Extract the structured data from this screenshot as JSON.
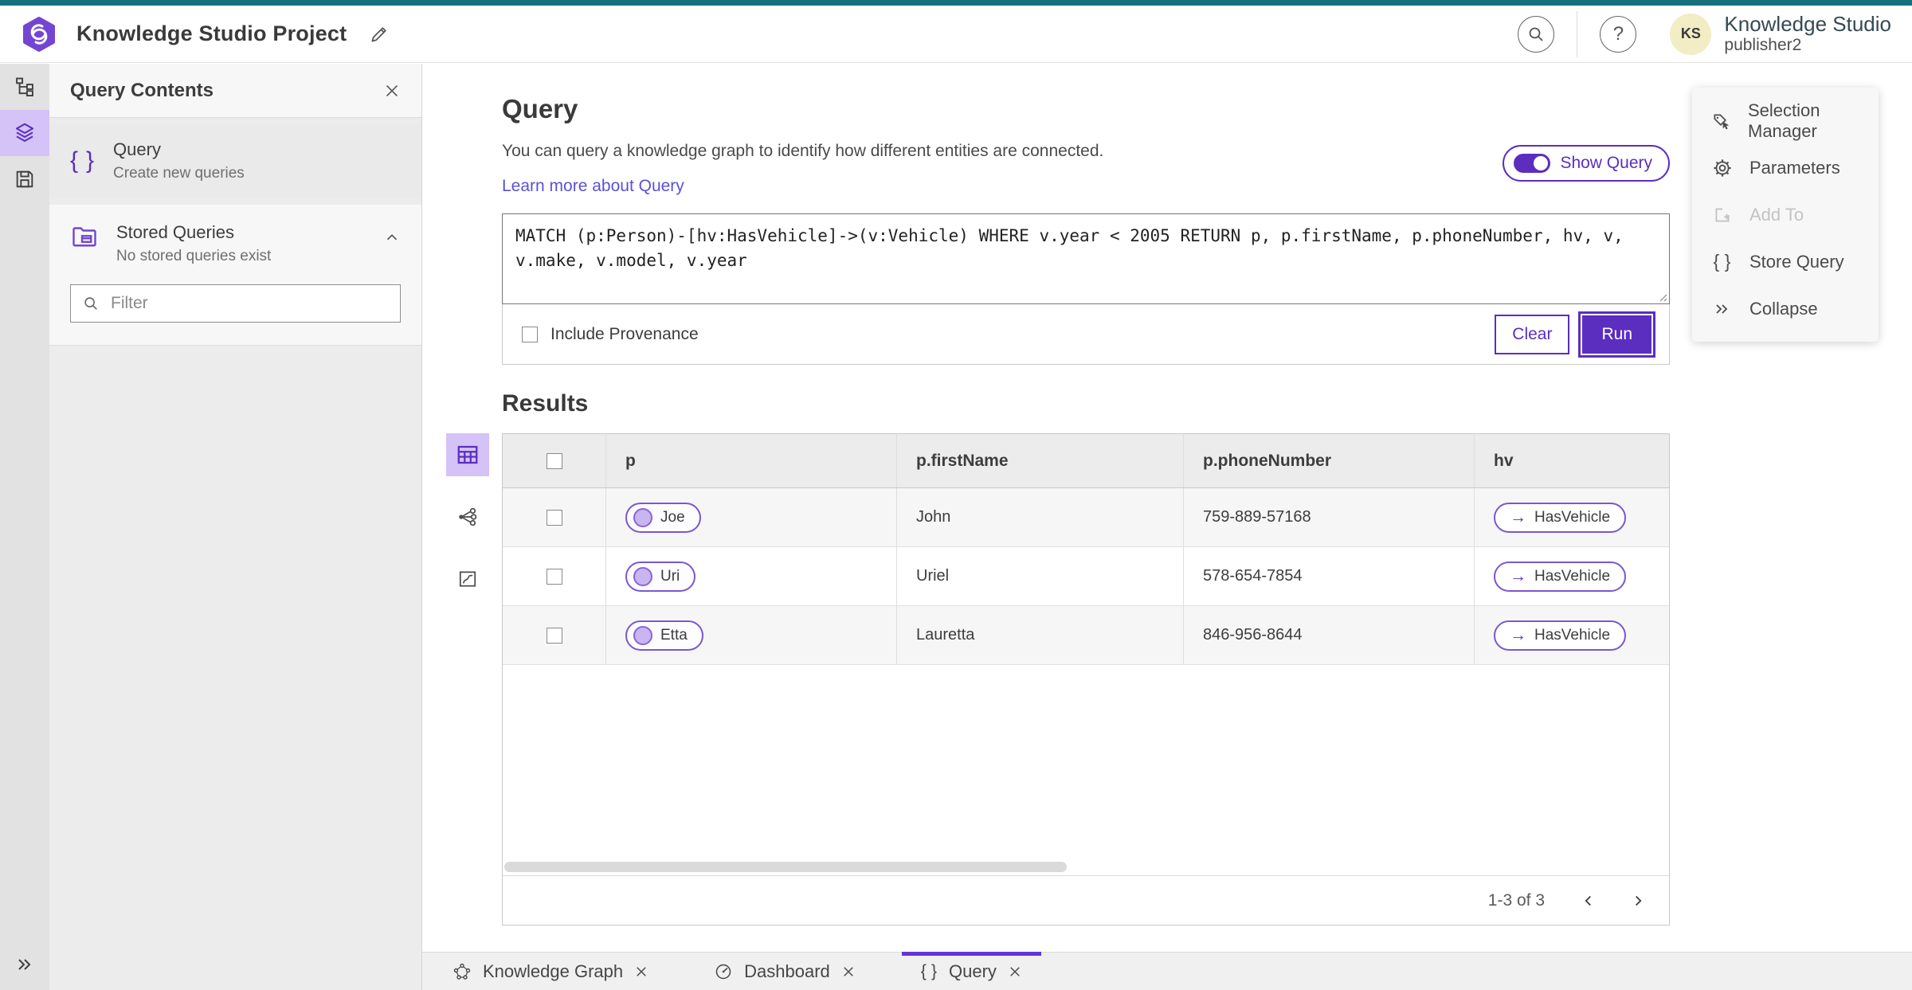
{
  "header": {
    "app_title": "Knowledge Studio Project",
    "user_name": "Knowledge Studio",
    "user_role": "publisher2",
    "avatar_initials": "KS"
  },
  "left_panel": {
    "title": "Query Contents",
    "query_item": {
      "title": "Query",
      "subtitle": "Create new queries"
    },
    "stored_queries": {
      "title": "Stored Queries",
      "subtitle": "No stored queries exist"
    },
    "filter_placeholder": "Filter"
  },
  "query_section": {
    "title": "Query",
    "description": "You can query a knowledge graph to identify how different entities are connected.",
    "learn_more": "Learn more about Query",
    "show_query_label": "Show Query",
    "query_text": "MATCH (p:Person)-[hv:HasVehicle]->(v:Vehicle) WHERE v.year < 2005 RETURN p, p.firstName, p.phoneNumber, hv, v, v.make, v.model, v.year",
    "include_provenance_label": "Include Provenance",
    "clear_label": "Clear",
    "run_label": "Run"
  },
  "results": {
    "title": "Results",
    "columns": [
      "p",
      "p.firstName",
      "p.phoneNumber",
      "hv"
    ],
    "rows": [
      {
        "p": "Joe",
        "firstName": "John",
        "phoneNumber": "759-889-57168",
        "hv": "HasVehicle"
      },
      {
        "p": "Uri",
        "firstName": "Uriel",
        "phoneNumber": "578-654-7854",
        "hv": "HasVehicle"
      },
      {
        "p": "Etta",
        "firstName": "Lauretta",
        "phoneNumber": "846-956-8644",
        "hv": "HasVehicle"
      }
    ],
    "edge_arrow": "→",
    "pagination": "1-3 of 3"
  },
  "right_panel": {
    "items": [
      {
        "label": "Selection Manager",
        "disabled": false
      },
      {
        "label": "Parameters",
        "disabled": false
      },
      {
        "label": "Add To",
        "disabled": true
      },
      {
        "label": "Store Query",
        "disabled": false
      },
      {
        "label": "Collapse",
        "disabled": false
      }
    ]
  },
  "tabs": [
    {
      "label": "Knowledge Graph",
      "active": false
    },
    {
      "label": "Dashboard",
      "active": false
    },
    {
      "label": "Query",
      "active": true
    }
  ],
  "colors": {
    "accent": "#5b2ec0",
    "accent_light": "#d5c2f6",
    "link": "#5a52d5",
    "teal_top": "#15707c",
    "avatar_bg": "#f2edc4"
  }
}
